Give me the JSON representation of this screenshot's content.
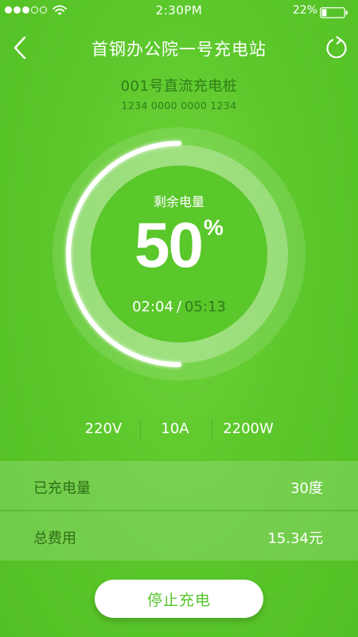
{
  "status_bar": {
    "time": "2:30PM",
    "battery_pct": "22%",
    "signal_bars_filled": 3,
    "signal_bars_total": 5,
    "battery_level": 0.22
  },
  "nav": {
    "title": "首钢办公院一号充电站",
    "back_icon": "chevron-left-icon",
    "refresh_icon": "refresh-icon"
  },
  "pile": {
    "name": "001号直流充电桩",
    "number": "1234 0000 0000 1234"
  },
  "gauge": {
    "label": "剩余电量",
    "value": "50",
    "unit": "%",
    "level": 0.5,
    "elapsed": "02:04",
    "separator": "/",
    "total": "05:13"
  },
  "stats": {
    "voltage": "220V",
    "current": "10A",
    "power": "2200W"
  },
  "info": {
    "charged_label": "已充电量",
    "charged_value": "30度",
    "fee_label": "总费用",
    "fee_value": "15.34元"
  },
  "actions": {
    "stop_label": "停止充电"
  },
  "colors": {
    "background": "#5cc82c",
    "accent_dark": "#2e7d18",
    "button_text": "#55c42a",
    "white": "#ffffff"
  }
}
